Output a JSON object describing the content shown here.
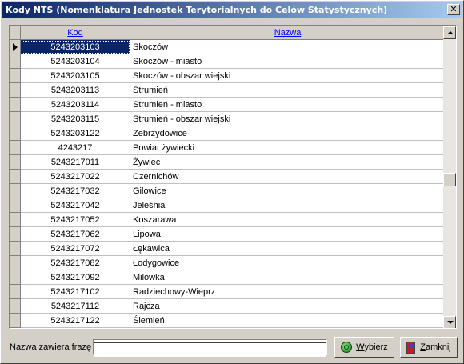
{
  "window": {
    "title": "Kody NTS (Nomenklatura Jednostek Terytorialnych do Celów Statystycznych)",
    "close_glyph": "✕"
  },
  "grid": {
    "columns": [
      "Kod",
      "Nazwa"
    ],
    "rows": [
      {
        "kod": "5243203103",
        "nazwa": "Skoczów",
        "selected": true
      },
      {
        "kod": "5243203104",
        "nazwa": "Skoczów - miasto"
      },
      {
        "kod": "5243203105",
        "nazwa": "Skoczów - obszar wiejski"
      },
      {
        "kod": "5243203113",
        "nazwa": "Strumień"
      },
      {
        "kod": "5243203114",
        "nazwa": "Strumień - miasto"
      },
      {
        "kod": "5243203115",
        "nazwa": "Strumień - obszar wiejski"
      },
      {
        "kod": "5243203122",
        "nazwa": "Zebrzydowice"
      },
      {
        "kod": "4243217",
        "nazwa": "Powiat żywiecki"
      },
      {
        "kod": "5243217011",
        "nazwa": "Żywiec"
      },
      {
        "kod": "5243217022",
        "nazwa": "Czernichów"
      },
      {
        "kod": "5243217032",
        "nazwa": "Gilowice"
      },
      {
        "kod": "5243217042",
        "nazwa": "Jeleśnia"
      },
      {
        "kod": "5243217052",
        "nazwa": "Koszarawa"
      },
      {
        "kod": "5243217062",
        "nazwa": "Lipowa"
      },
      {
        "kod": "5243217072",
        "nazwa": "Łękawica"
      },
      {
        "kod": "5243217082",
        "nazwa": "Łodygowice"
      },
      {
        "kod": "5243217092",
        "nazwa": "Milówka"
      },
      {
        "kod": "5243217102",
        "nazwa": "Radziechowy-Wieprz"
      },
      {
        "kod": "5243217112",
        "nazwa": "Rajcza"
      },
      {
        "kod": "5243217122",
        "nazwa": "Ślemień"
      }
    ]
  },
  "filter": {
    "label": "Nazwa zawiera frazę",
    "value": ""
  },
  "buttons": {
    "select_label": "Wybierz",
    "close_label": "Zamknij"
  },
  "colors": {
    "title_start": "#0a246a",
    "title_end": "#a6caf0",
    "selection": "#0a246a",
    "header_link": "#0000ff"
  }
}
